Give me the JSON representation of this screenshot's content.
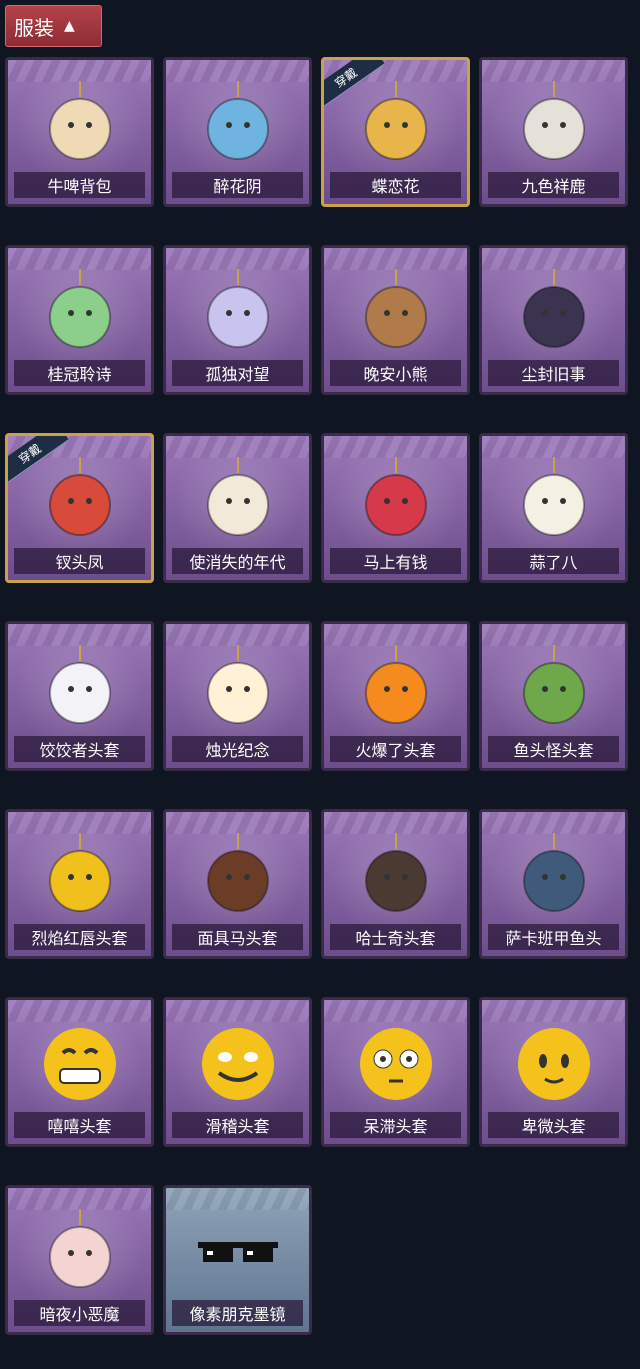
{
  "header": {
    "label": "服装"
  },
  "equipped_tag": "穿戴",
  "items": [
    {
      "name": "牛啤背包",
      "icon": "cow-beer-backpack-icon",
      "equipped": false
    },
    {
      "name": "醉花阴",
      "icon": "flower-dreamcatcher-icon",
      "equipped": false
    },
    {
      "name": "蝶恋花",
      "icon": "butterfly-bell-icon",
      "equipped": true
    },
    {
      "name": "九色祥鹿",
      "icon": "deer-charm-icon",
      "equipped": false
    },
    {
      "name": "桂冠聆诗",
      "icon": "laurel-doll-icon",
      "equipped": false
    },
    {
      "name": "孤独对望",
      "icon": "lonely-gaze-doll-icon",
      "equipped": false
    },
    {
      "name": "晚安小熊",
      "icon": "teddy-bear-icon",
      "equipped": false
    },
    {
      "name": "尘封旧事",
      "icon": "dusty-doll-icon",
      "equipped": false
    },
    {
      "name": "钗头凤",
      "icon": "phoenix-crown-icon",
      "equipped": true
    },
    {
      "name": "使消失的年代",
      "icon": "vanished-era-doll-icon",
      "equipped": false
    },
    {
      "name": "马上有钱",
      "icon": "red-horse-icon",
      "equipped": false
    },
    {
      "name": "蒜了八",
      "icon": "garlic-icon",
      "equipped": false
    },
    {
      "name": "饺饺者头套",
      "icon": "dumpling-head-icon",
      "equipped": false
    },
    {
      "name": "烛光纪念",
      "icon": "candle-head-icon",
      "equipped": false
    },
    {
      "name": "火爆了头套",
      "icon": "fire-head-icon",
      "equipped": false
    },
    {
      "name": "鱼头怪头套",
      "icon": "fish-head-icon",
      "equipped": false
    },
    {
      "name": "烈焰红唇头套",
      "icon": "red-lips-head-icon",
      "equipped": false
    },
    {
      "name": "面具马头套",
      "icon": "horse-mask-icon",
      "equipped": false
    },
    {
      "name": "哈士奇头套",
      "icon": "husky-head-icon",
      "equipped": false
    },
    {
      "name": "萨卡班甲鱼头",
      "icon": "sacabambaspis-head-icon",
      "equipped": false
    },
    {
      "name": "嘻嘻头套",
      "icon": "grin-emoji-head-icon",
      "equipped": false
    },
    {
      "name": "滑稽头套",
      "icon": "funny-emoji-head-icon",
      "equipped": false
    },
    {
      "name": "呆滞头套",
      "icon": "dazed-emoji-head-icon",
      "equipped": false
    },
    {
      "name": "卑微头套",
      "icon": "humble-emoji-head-icon",
      "equipped": false
    },
    {
      "name": "暗夜小恶魔",
      "icon": "little-devil-head-icon",
      "equipped": false
    },
    {
      "name": "像素朋克墨镜",
      "icon": "pixel-sunglasses-icon",
      "equipped": false,
      "plain": true
    }
  ]
}
